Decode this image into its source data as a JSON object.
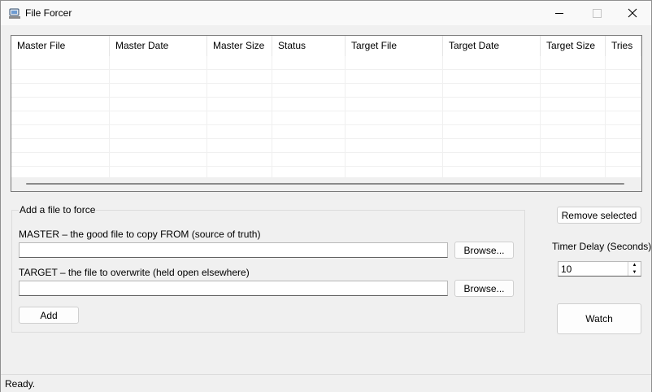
{
  "window": {
    "title": "File Forcer",
    "icons": {
      "app": "app-icon",
      "minimize": "minimize-icon",
      "maximize": "maximize-icon",
      "close": "close-icon"
    }
  },
  "list": {
    "columns": [
      "Master File",
      "Master Date",
      "Master Size",
      "Status",
      "Target File",
      "Target Date",
      "Target Size",
      "Tries"
    ],
    "rows": []
  },
  "form": {
    "group_title": "Add a file to force",
    "master_label": "MASTER  –  the good file to copy FROM (source of truth)",
    "master_value": "",
    "master_browse": "Browse...",
    "target_label": "TARGET  –  the file to overwrite (held open elsewhere)",
    "target_value": "",
    "target_browse": "Browse...",
    "add_button": "Add"
  },
  "side": {
    "remove_button": "Remove selected",
    "timer_label": "Timer Delay (Seconds)",
    "timer_value": "10",
    "watch_button": "Watch"
  },
  "status": {
    "text": "Ready."
  }
}
